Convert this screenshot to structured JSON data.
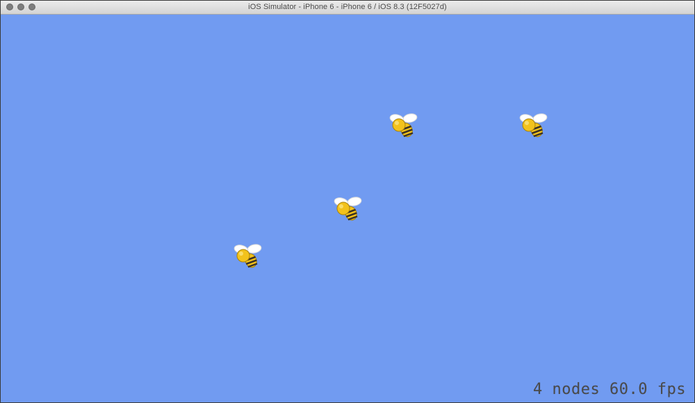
{
  "window": {
    "title": "iOS Simulator - iPhone 6 - iPhone 6 / iOS 8.3 (12F5027d)"
  },
  "scene": {
    "background_color": "#719bf1",
    "sprites": [
      {
        "name": "bee",
        "icon": "bee-icon"
      },
      {
        "name": "bee",
        "icon": "bee-icon"
      },
      {
        "name": "bee",
        "icon": "bee-icon"
      },
      {
        "name": "bee",
        "icon": "bee-icon"
      }
    ]
  },
  "stats": {
    "nodes_count": "4",
    "nodes_label": "nodes",
    "fps_value": "60.0",
    "fps_label": "fps"
  },
  "colors": {
    "bee_body": "#f2c21c",
    "bee_stripe": "#3a3226",
    "bee_wing": "#ffffff"
  }
}
